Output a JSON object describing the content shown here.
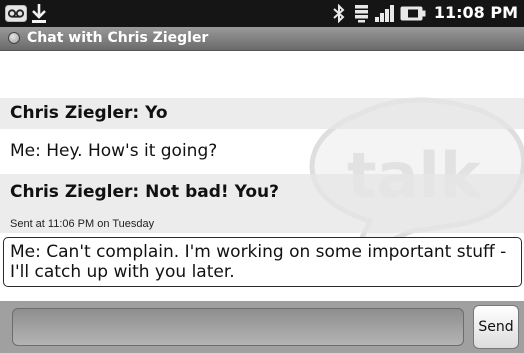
{
  "status_bar": {
    "time": "11:08 PM",
    "icons": [
      "voicemail-icon",
      "download-icon",
      "bluetooth-icon",
      "wifi-icon",
      "signal-icon",
      "battery-icon"
    ]
  },
  "title_bar": {
    "title": "Chat with Chris Ziegler"
  },
  "watermark": {
    "text": "talk"
  },
  "messages": [
    {
      "text": "Chris Ziegler: Yo"
    },
    {
      "text": "Me: Hey. How's it going?"
    },
    {
      "text": "Chris Ziegler: Not bad! You?"
    },
    {
      "text": "Me: Can't complain. I'm working on some important stuff - I'll catch up with you later."
    }
  ],
  "sent_meta": "Sent at 11:06 PM on Tuesday",
  "composer": {
    "placeholder": "",
    "send_label": "Send"
  },
  "colors": {
    "status_bar": "#151515",
    "title_bar": "#7f7f7f",
    "composer_bg": "#a0a0a0"
  }
}
